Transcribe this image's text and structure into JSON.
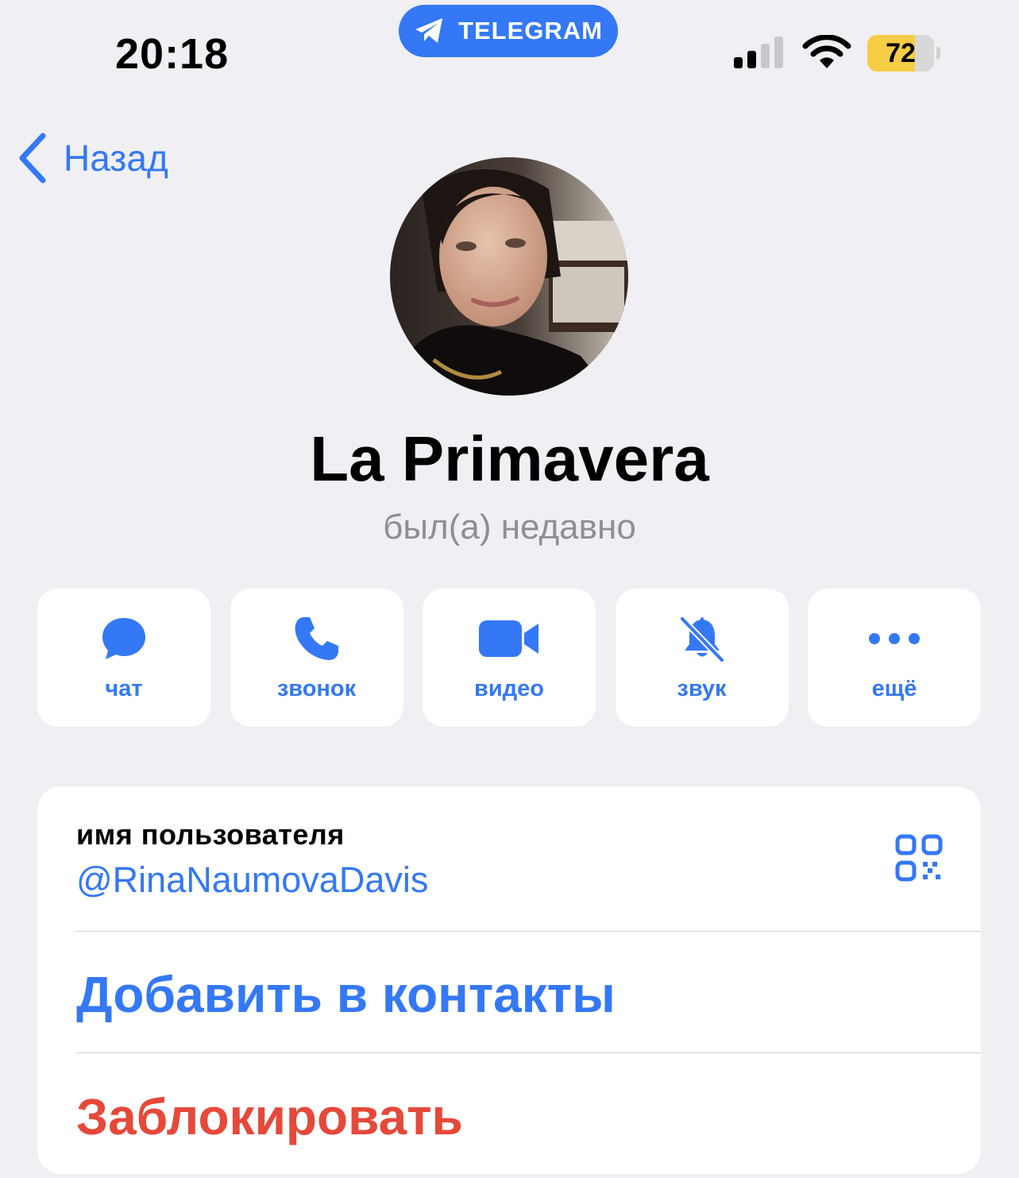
{
  "status_bar": {
    "time": "20:18",
    "app_pill": "TELEGRAM",
    "battery_level": "72",
    "battery_fraction": 0.72
  },
  "nav": {
    "back_label": "Назад"
  },
  "profile": {
    "name": "La Primavera",
    "last_seen": "был(а) недавно"
  },
  "actions": [
    {
      "label": "чат",
      "icon": "chat-bubble-icon"
    },
    {
      "label": "звонок",
      "icon": "phone-icon"
    },
    {
      "label": "видео",
      "icon": "video-camera-icon"
    },
    {
      "label": "звук",
      "icon": "bell-slash-icon"
    },
    {
      "label": "ещё",
      "icon": "more-dots-icon"
    }
  ],
  "info": {
    "username_label": "имя пользователя",
    "username": "@RinaNaumovaDavis",
    "add_contact": "Добавить в контакты",
    "block": "Заблокировать"
  },
  "colors": {
    "accent": "#3478f6",
    "destructive": "#e5493a",
    "background": "#efeff4",
    "secondary_text": "#8e8e93"
  }
}
